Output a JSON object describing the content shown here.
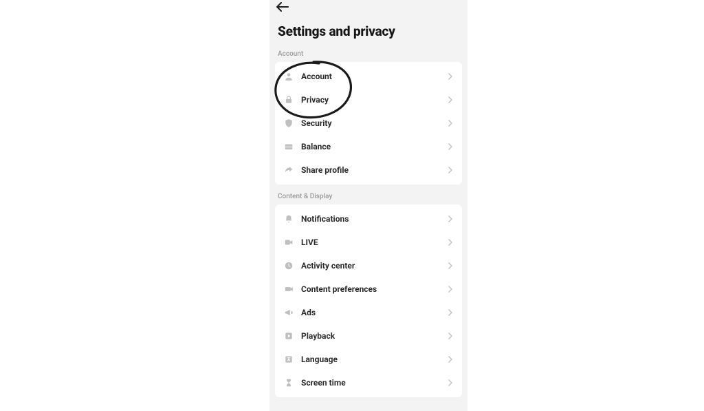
{
  "title": "Settings and privacy",
  "sections": [
    {
      "label": "Account",
      "items": [
        {
          "id": "account",
          "label": "Account",
          "icon": "person-icon"
        },
        {
          "id": "privacy",
          "label": "Privacy",
          "icon": "lock-icon"
        },
        {
          "id": "security",
          "label": "Security",
          "icon": "shield-icon"
        },
        {
          "id": "balance",
          "label": "Balance",
          "icon": "wallet-icon"
        },
        {
          "id": "share",
          "label": "Share profile",
          "icon": "share-icon"
        }
      ]
    },
    {
      "label": "Content & Display",
      "items": [
        {
          "id": "notifications",
          "label": "Notifications",
          "icon": "bell-icon"
        },
        {
          "id": "live",
          "label": "LIVE",
          "icon": "video-icon"
        },
        {
          "id": "activity",
          "label": "Activity center",
          "icon": "clock-icon"
        },
        {
          "id": "content",
          "label": "Content preferences",
          "icon": "film-icon"
        },
        {
          "id": "ads",
          "label": "Ads",
          "icon": "megaphone-icon"
        },
        {
          "id": "playback",
          "label": "Playback",
          "icon": "play-icon"
        },
        {
          "id": "language",
          "label": "Language",
          "icon": "language-icon"
        },
        {
          "id": "screentime",
          "label": "Screen time",
          "icon": "hourglass-icon"
        }
      ]
    }
  ],
  "annotation": {
    "target": "privacy",
    "style": "hand-drawn-circle"
  }
}
